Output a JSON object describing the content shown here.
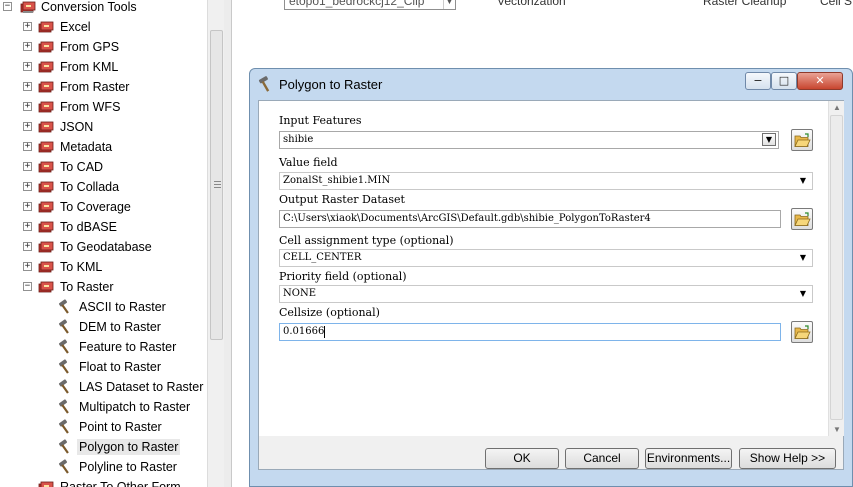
{
  "tree": {
    "rows": [
      {
        "label": "Conversion Tools",
        "kind": "toolbox",
        "expander": "−"
      },
      {
        "label": "Excel",
        "kind": "toolset",
        "expander": "+"
      },
      {
        "label": "From GPS",
        "kind": "toolset",
        "expander": "+"
      },
      {
        "label": "From KML",
        "kind": "toolset",
        "expander": "+"
      },
      {
        "label": "From Raster",
        "kind": "toolset",
        "expander": "+"
      },
      {
        "label": "From WFS",
        "kind": "toolset",
        "expander": "+"
      },
      {
        "label": "JSON",
        "kind": "toolset",
        "expander": "+"
      },
      {
        "label": "Metadata",
        "kind": "toolset",
        "expander": "+"
      },
      {
        "label": "To CAD",
        "kind": "toolset",
        "expander": "+"
      },
      {
        "label": "To Collada",
        "kind": "toolset",
        "expander": "+"
      },
      {
        "label": "To Coverage",
        "kind": "toolset",
        "expander": "+"
      },
      {
        "label": "To dBASE",
        "kind": "toolset",
        "expander": "+"
      },
      {
        "label": "To Geodatabase",
        "kind": "toolset",
        "expander": "+"
      },
      {
        "label": "To KML",
        "kind": "toolset",
        "expander": "+"
      },
      {
        "label": "To Raster",
        "kind": "toolset",
        "expander": "−"
      },
      {
        "label": "ASCII to Raster",
        "kind": "tool"
      },
      {
        "label": "DEM to Raster",
        "kind": "tool"
      },
      {
        "label": "Feature to Raster",
        "kind": "tool"
      },
      {
        "label": "Float to Raster",
        "kind": "tool"
      },
      {
        "label": "LAS Dataset to Raster",
        "kind": "tool"
      },
      {
        "label": "Multipatch to Raster",
        "kind": "tool"
      },
      {
        "label": "Point to Raster",
        "kind": "tool"
      },
      {
        "label": "Polygon to Raster",
        "kind": "tool",
        "selected": true
      },
      {
        "label": "Polyline to Raster",
        "kind": "tool"
      },
      {
        "label": "Raster To Other Form",
        "kind": "toolset-partial"
      }
    ]
  },
  "bg_toolbar": {
    "layer_combo": "etopo1_bedrockcj12_Clip",
    "vectorization": "Vectorization",
    "raster_cleanup": "Raster Cleanup",
    "cell_label": "Cell S"
  },
  "dialog": {
    "title": "Polygon to Raster",
    "title_icon": "hammer-icon",
    "caption_min": "−",
    "caption_max": "□",
    "caption_close": "✕",
    "params": {
      "input_features": {
        "label": "Input Features",
        "value": "shibie"
      },
      "value_field": {
        "label": "Value field",
        "value": "ZonalSt_shibie1.MIN"
      },
      "output_raster": {
        "label": "Output Raster Dataset",
        "value": "C:\\Users\\xiaok\\Documents\\ArcGIS\\Default.gdb\\shibie_PolygonToRaster4"
      },
      "cell_assignment": {
        "label": "Cell assignment type (optional)",
        "value": "CELL_CENTER"
      },
      "priority_field": {
        "label": "Priority field (optional)",
        "value": "NONE"
      },
      "cellsize": {
        "label": "Cellsize (optional)",
        "value": "0.01666"
      }
    },
    "buttons": {
      "ok": "OK",
      "cancel": "Cancel",
      "environments": "Environments...",
      "show_help": "Show Help >>"
    }
  },
  "colors": {
    "dialog_frame": "#c4d9ef",
    "close_button": "#c8452f",
    "toolbox_red": "#b3322b",
    "folder_yellow": "#e8b84a"
  }
}
